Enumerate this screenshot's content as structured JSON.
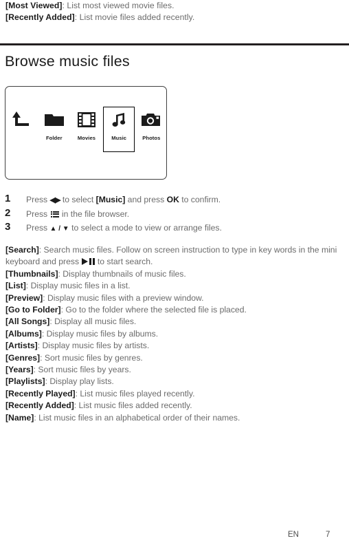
{
  "carryover": [
    {
      "label": "[Most Viewed]",
      "text": ": List most viewed movie files."
    },
    {
      "label": "[Recently Added]",
      "text": ": List movie files added recently."
    }
  ],
  "section": {
    "heading": "Browse music files"
  },
  "panel": {
    "items": [
      {
        "caption": "",
        "icon": "back-arrow-icon",
        "selected": false
      },
      {
        "caption": "Folder",
        "icon": "folder-icon",
        "selected": false
      },
      {
        "caption": "Movies",
        "icon": "film-strip-icon",
        "selected": false
      },
      {
        "caption": "Music",
        "icon": "music-note-icon",
        "selected": true
      },
      {
        "caption": "Photos",
        "icon": "camera-icon",
        "selected": false
      }
    ]
  },
  "steps": [
    {
      "number": "1",
      "pre": "Press ",
      "glyph": "left-right-arrows-icon",
      "mid": " to select ",
      "strong1": "[Music]",
      "mid2": " and press ",
      "strong2": "OK",
      "post": " to confirm."
    },
    {
      "number": "2",
      "pre": "Press ",
      "glyph": "list-menu-icon",
      "post": " in the file browser."
    },
    {
      "number": "3",
      "pre": "Press ",
      "glyph": "up-down-arrows-icon",
      "post": " to select a mode to view or arrange files."
    }
  ],
  "descriptions": [
    {
      "label": "[Search]",
      "text": ": Search music files. Follow on screen instruction to type in key words in the mini keyboard and press ",
      "glyph": "play-pause-icon",
      "text2": " to start search."
    },
    {
      "label": "[Thumbnails]",
      "text": ": Display thumbnails of music files."
    },
    {
      "label": "[List]",
      "text": ": Display music files in a list."
    },
    {
      "label": "[Preview]",
      "text": ": Display music files with a preview window."
    },
    {
      "label": "[Go to Folder]",
      "text": ": Go to the folder where the selected file is placed."
    },
    {
      "label": "[All Songs]",
      "text": ": Display all music files."
    },
    {
      "label": "[Albums]",
      "text": ": Display music files by albums."
    },
    {
      "label": "[Artists]",
      "text": ": Display music files by artists."
    },
    {
      "label": "[Genres]",
      "text": ": Sort music files by genres."
    },
    {
      "label": "[Years]",
      "text": ": Sort music files by years."
    },
    {
      "label": "[Playlists]",
      "text": ": Display play lists."
    },
    {
      "label": "[Recently Played]",
      "text": ": List music files played recently."
    },
    {
      "label": "[Recently Added]",
      "text": ": List music files added recently."
    },
    {
      "label": "[Name]",
      "text": ": List music files in an alphabetical order of their names."
    }
  ],
  "footer": {
    "language": "EN",
    "page": "7"
  },
  "colors": {
    "rule": "#231f20",
    "label_text": "#1b1b1b",
    "body_text": "#6b6b6b",
    "panel_border": "#404040"
  }
}
